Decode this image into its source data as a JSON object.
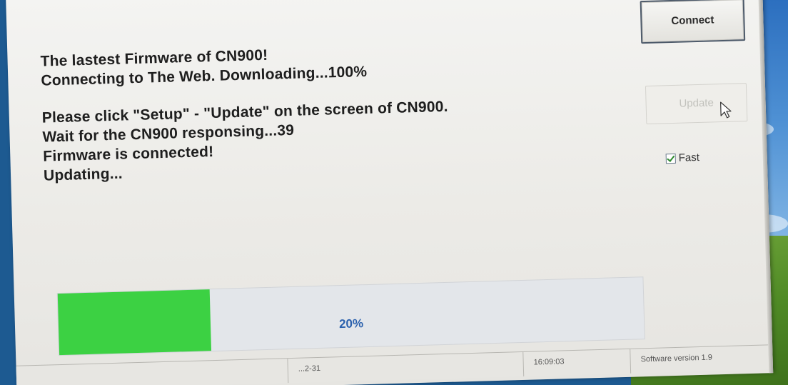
{
  "log": {
    "line1": "The lastest Firmware of CN900!",
    "line2": "Connecting to The Web. Downloading...100%",
    "line3": "Please click \"Setup\" - \"Update\" on the screen of CN900.",
    "line4": "Wait for the CN900 responsing...39",
    "line5": "Firmware is connected!",
    "line6": "Updating..."
  },
  "buttons": {
    "connect_label": "Connect",
    "update_label": "Update",
    "update_state": "disabled"
  },
  "options": {
    "fast_label": "Fast",
    "fast_checked": true
  },
  "progress": {
    "value": 0.26,
    "label": "20%",
    "fill_color": "#3cd143",
    "text_color": "#2b61ad"
  },
  "statusbar": {
    "date_partial": "...2-31",
    "time": "16:09:03",
    "version": "Software version 1.9"
  },
  "icons": {
    "cursor": "mouse-pointer-icon",
    "checkbox": "checkmark-icon"
  }
}
